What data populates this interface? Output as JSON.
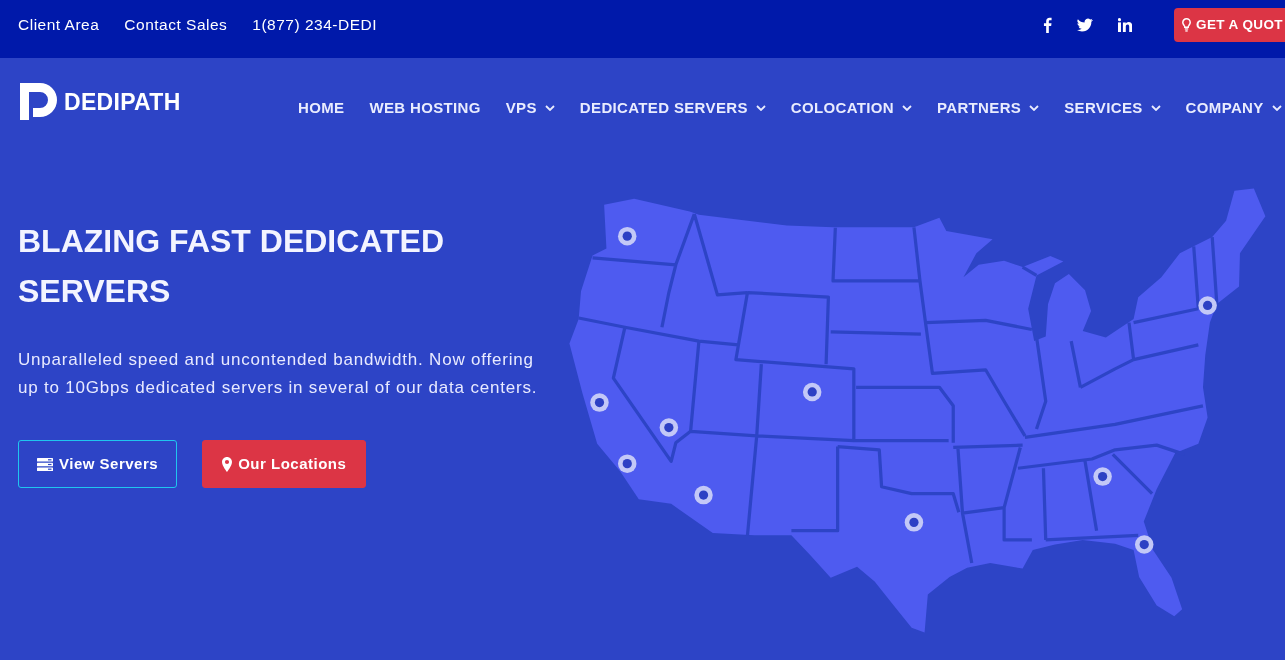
{
  "top_bar": {
    "links": [
      "Client Area",
      "Contact Sales",
      "1(877) 234-DEDI"
    ],
    "quote_button": "GET A QUOT"
  },
  "logo": "DEDIPATH",
  "nav": [
    {
      "label": "HOME",
      "has_menu": false
    },
    {
      "label": "WEB HOSTING",
      "has_menu": false
    },
    {
      "label": "VPS",
      "has_menu": true
    },
    {
      "label": "DEDICATED SERVERS",
      "has_menu": true
    },
    {
      "label": "COLOCATION",
      "has_menu": true
    },
    {
      "label": "PARTNERS",
      "has_menu": true
    },
    {
      "label": "SERVICES",
      "has_menu": true
    },
    {
      "label": "COMPANY",
      "has_menu": true
    }
  ],
  "hero": {
    "title": "BLAZING FAST DEDICATED SERVERS",
    "text": "Unparalleled speed and uncontended bandwidth. Now offering up to 10Gbps dedicated servers in several of our data centers.",
    "buttons": [
      {
        "label": "View Servers",
        "kind": "outline"
      },
      {
        "label": "Our Locations",
        "kind": "filled"
      }
    ]
  }
}
